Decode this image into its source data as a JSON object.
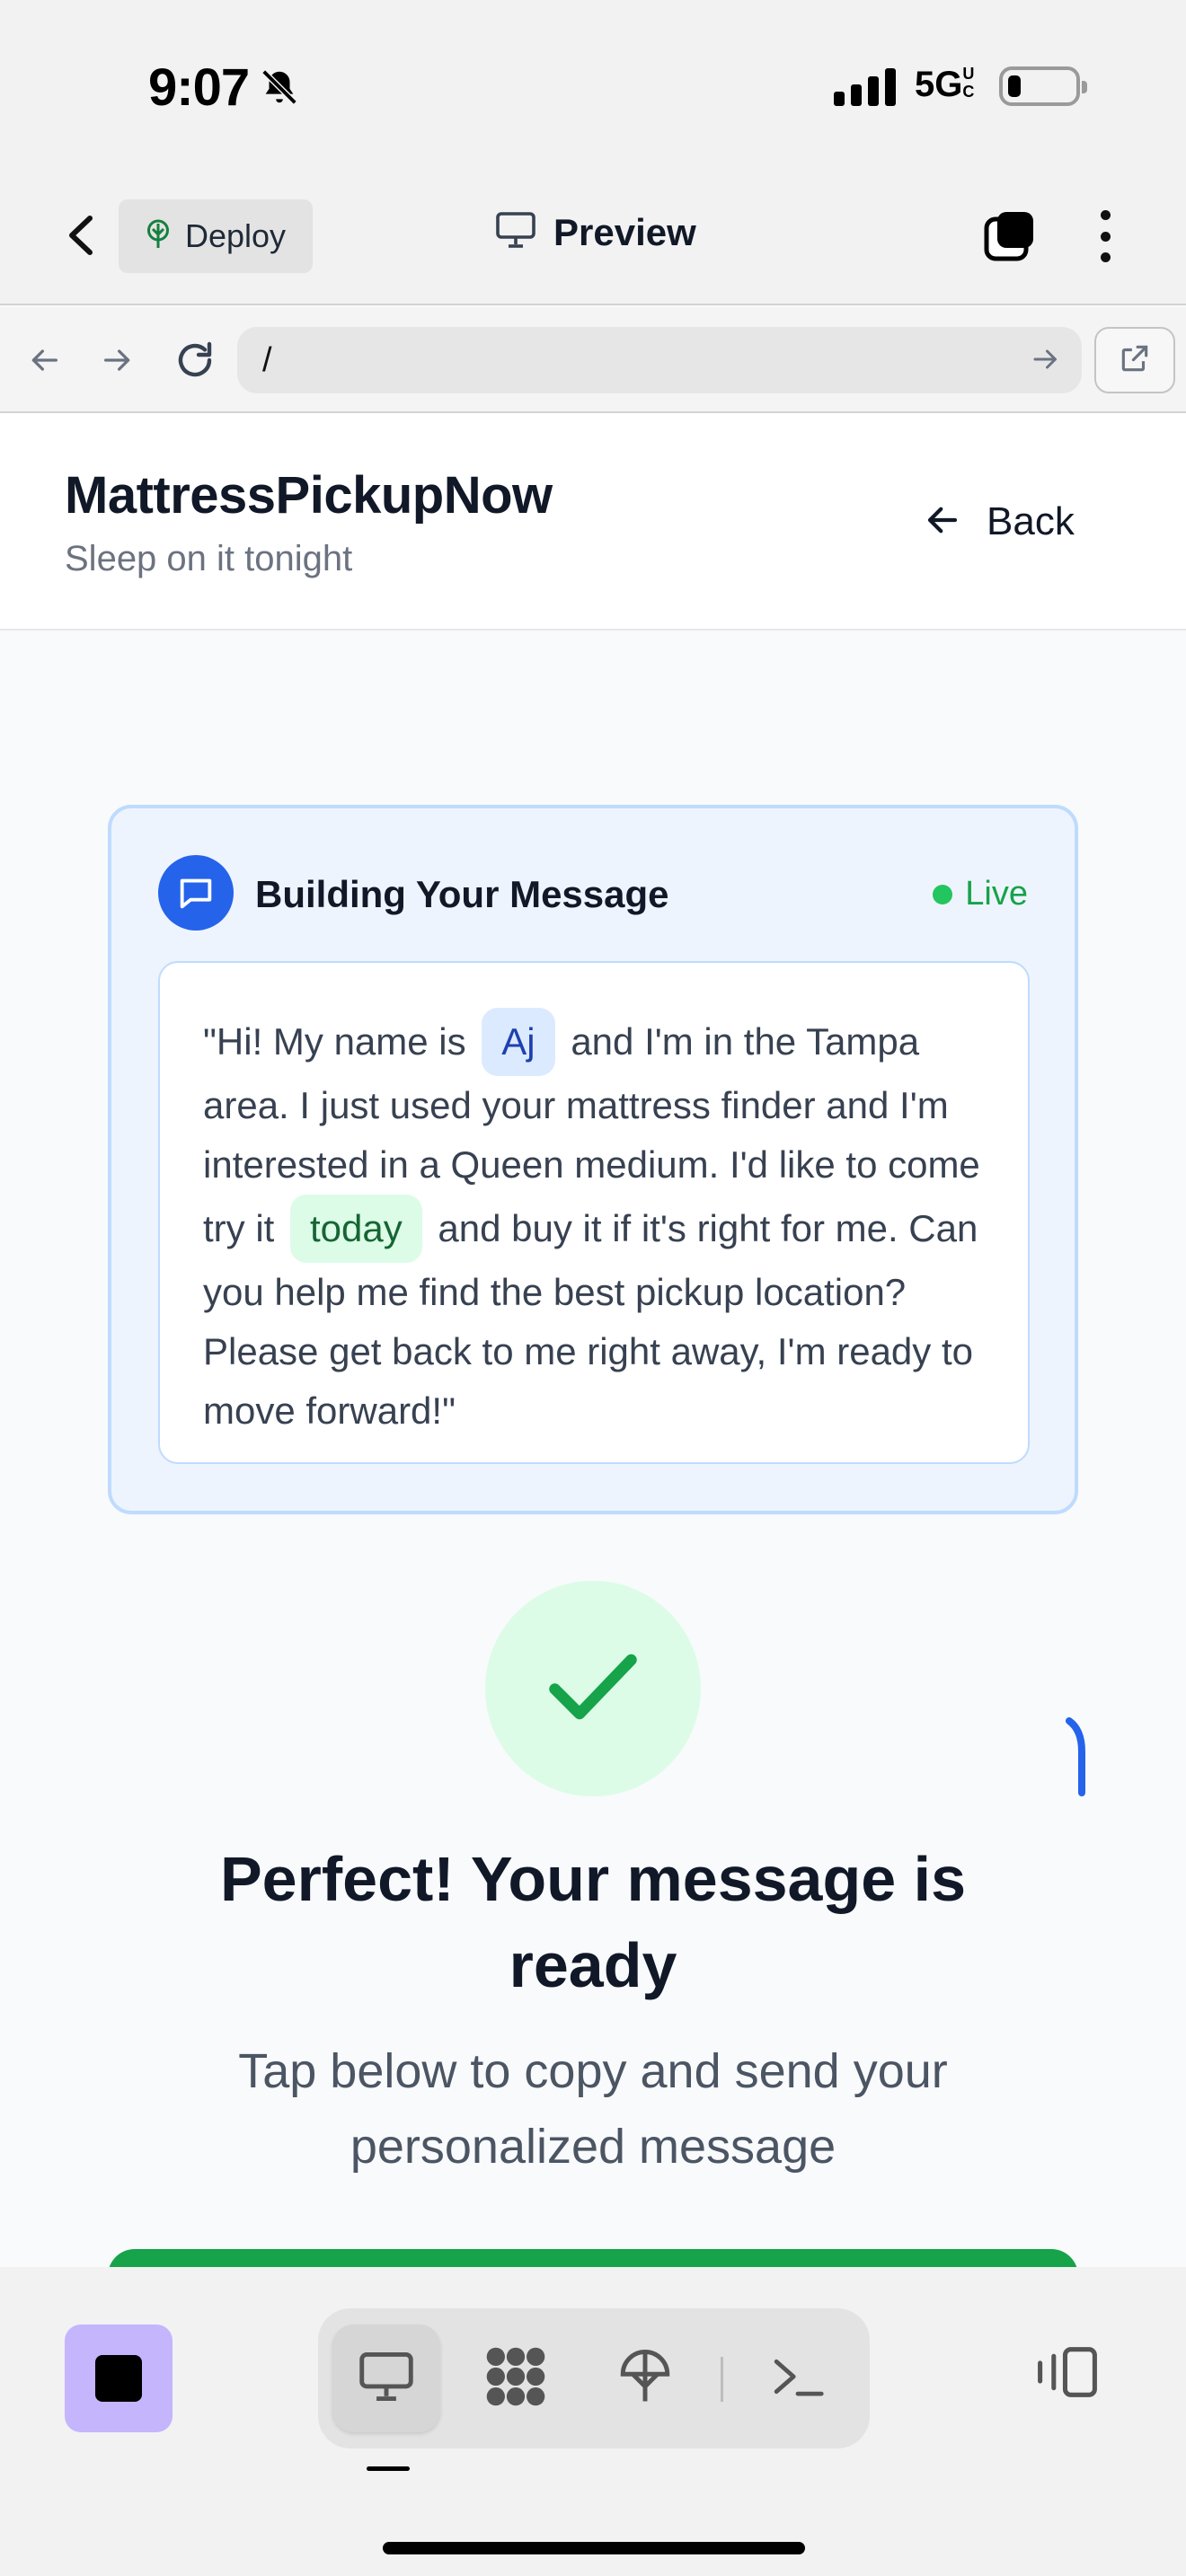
{
  "status_bar": {
    "time": "9:07",
    "network": "5G",
    "network_sup": "UC"
  },
  "app_header": {
    "deploy_label": "Deploy",
    "preview_label": "Preview"
  },
  "browser": {
    "url": "/"
  },
  "page": {
    "brand": "MattressPickupNow",
    "tagline": "Sleep on it tonight",
    "back_label": "Back"
  },
  "message_card": {
    "title": "Building Your Message",
    "live_label": "Live",
    "text_1": "\"Hi! My name is",
    "name_chip": "Aj",
    "text_2": "and I'm in the Tampa area. I just used your mattress finder and I'm interested in a Queen medium. I'd like to come try it",
    "time_chip": "today",
    "text_3": "and buy it if it's right for me. Can you help me find the best pickup location? Please get back to me right away, I'm ready to move forward!\""
  },
  "success": {
    "title": "Perfect! Your message is ready",
    "subtitle": "Tap below to copy and send your personalized message"
  },
  "colors": {
    "brand_blue": "#2563eb",
    "success_green": "#16a34a",
    "live_green": "#22c55e",
    "stop_purple": "#c4b5fd"
  },
  "icons": {
    "bell": "bell-slash-icon",
    "deploy": "deploy-tree-icon",
    "preview": "monitor-icon",
    "message": "chat-bubble-icon",
    "check": "checkmark-icon"
  }
}
